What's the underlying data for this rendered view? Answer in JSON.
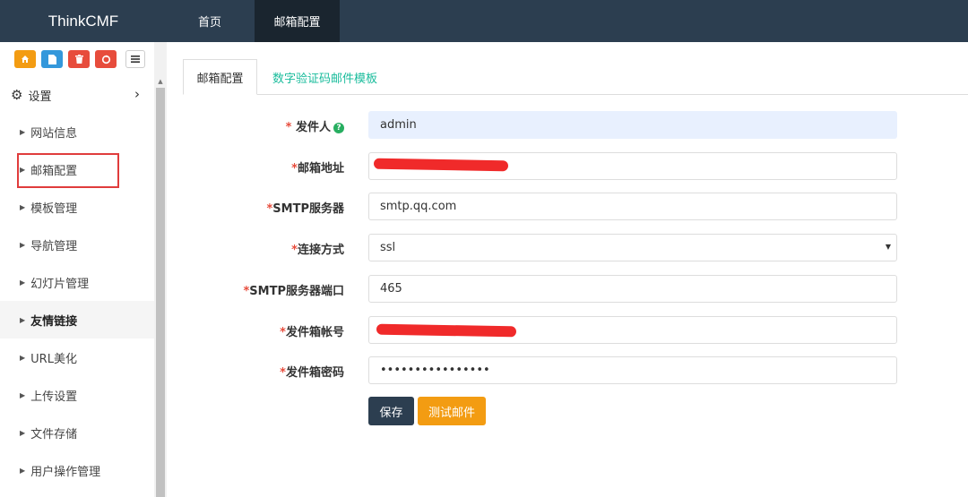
{
  "header": {
    "brand": "ThinkCMF",
    "nav": [
      {
        "label": "首页"
      },
      {
        "label": "邮箱配置"
      }
    ]
  },
  "shortcuts": [
    {
      "icon": "home-icon",
      "color": "#f39c12"
    },
    {
      "icon": "file-icon",
      "color": "#3498db"
    },
    {
      "icon": "trash-icon",
      "color": "#e74c3c"
    },
    {
      "icon": "recycle-icon",
      "color": "#e74c3c"
    },
    {
      "icon": "list-icon",
      "color": "#ffffff"
    }
  ],
  "sidebar": {
    "section": "设置",
    "items": [
      {
        "label": "网站信息"
      },
      {
        "label": "邮箱配置"
      },
      {
        "label": "模板管理"
      },
      {
        "label": "导航管理"
      },
      {
        "label": "幻灯片管理"
      },
      {
        "label": "友情链接"
      },
      {
        "label": "URL美化"
      },
      {
        "label": "上传设置"
      },
      {
        "label": "文件存储"
      },
      {
        "label": "用户操作管理"
      }
    ]
  },
  "tabs": [
    {
      "label": "邮箱配置"
    },
    {
      "label": "数字验证码邮件模板"
    }
  ],
  "form": {
    "sender": {
      "label": "发件人",
      "value": "admin"
    },
    "email_address": {
      "label": "邮箱地址",
      "value": ""
    },
    "smtp_server": {
      "label": "SMTP服务器",
      "value": "smtp.qq.com"
    },
    "connection": {
      "label": "连接方式",
      "value": "ssl"
    },
    "smtp_port": {
      "label": "SMTP服务器端口",
      "value": "465"
    },
    "account": {
      "label": "发件箱帐号",
      "value": ""
    },
    "password": {
      "label": "发件箱密码",
      "value": "••••••••••••••••"
    },
    "required_mark": "*"
  },
  "buttons": {
    "save": "保存",
    "test": "测试邮件"
  },
  "colors": {
    "topbar": "#2c3e50",
    "accent": "#1abc9c",
    "warning": "#f39c12",
    "danger": "#e74c3c"
  }
}
